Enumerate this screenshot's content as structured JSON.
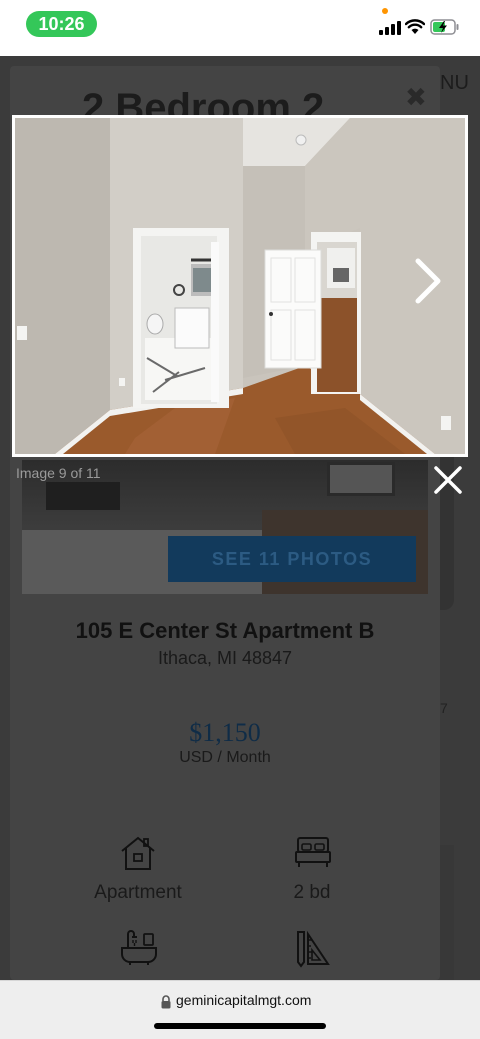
{
  "status_bar": {
    "time": "10:26"
  },
  "header": {
    "title": "2 Bedroom 2",
    "menu_text": "NU"
  },
  "right_edge_number": "7",
  "gallery": {
    "counter": "Image 9 of 11",
    "see_photos_label": "SEE 11 PHOTOS"
  },
  "listing": {
    "address": "105 E Center St Apartment B",
    "city": "Ithaca, MI 48847",
    "price": "$1,150",
    "price_unit": "USD / Month",
    "features": [
      {
        "icon": "house-icon",
        "label": "Apartment"
      },
      {
        "icon": "bed-icon",
        "label": "2 bd"
      },
      {
        "icon": "bath-icon",
        "label": ""
      },
      {
        "icon": "ruler-icon",
        "label": ""
      }
    ]
  },
  "browser": {
    "url": "geminicapitalmgt.com"
  },
  "colors": {
    "status_green": "#34c759",
    "button_blue": "#123a5c",
    "price_blue": "#0f2c47"
  }
}
